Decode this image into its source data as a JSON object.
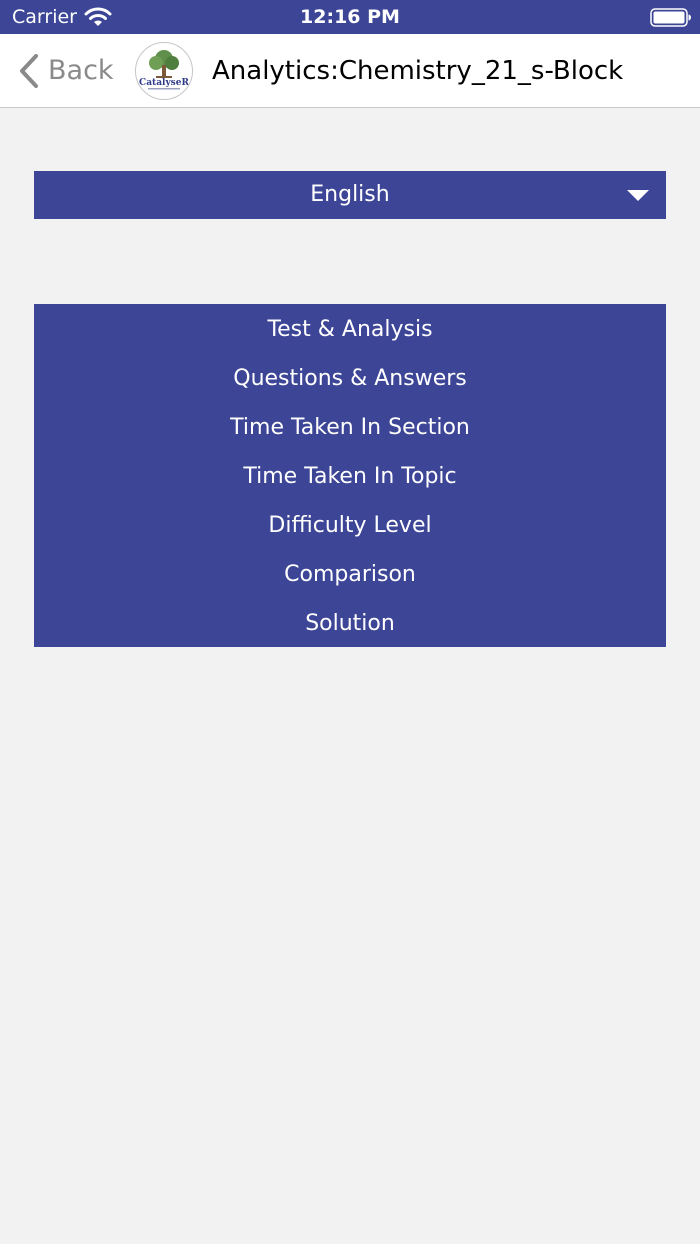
{
  "status_bar": {
    "carrier": "Carrier",
    "time": "12:16 PM",
    "wifi_icon": "wifi-icon",
    "battery_icon": "battery-icon"
  },
  "nav": {
    "back_label": "Back",
    "back_icon": "chevron-left-icon",
    "logo_text": "CatalyseR",
    "title": "Analytics:Chemistry_21_s-Block"
  },
  "language_select": {
    "selected": "English",
    "caret_icon": "caret-down-icon"
  },
  "menu": {
    "items": [
      {
        "label": "Test & Analysis"
      },
      {
        "label": "Questions & Answers"
      },
      {
        "label": "Time Taken In Section"
      },
      {
        "label": "Time Taken In Topic"
      },
      {
        "label": "Difficulty Level"
      },
      {
        "label": "Comparison"
      },
      {
        "label": "Solution"
      }
    ]
  },
  "colors": {
    "brand": "#3d4597",
    "background": "#f2f2f2",
    "nav_background": "#ffffff",
    "muted": "#8a8a8a"
  }
}
